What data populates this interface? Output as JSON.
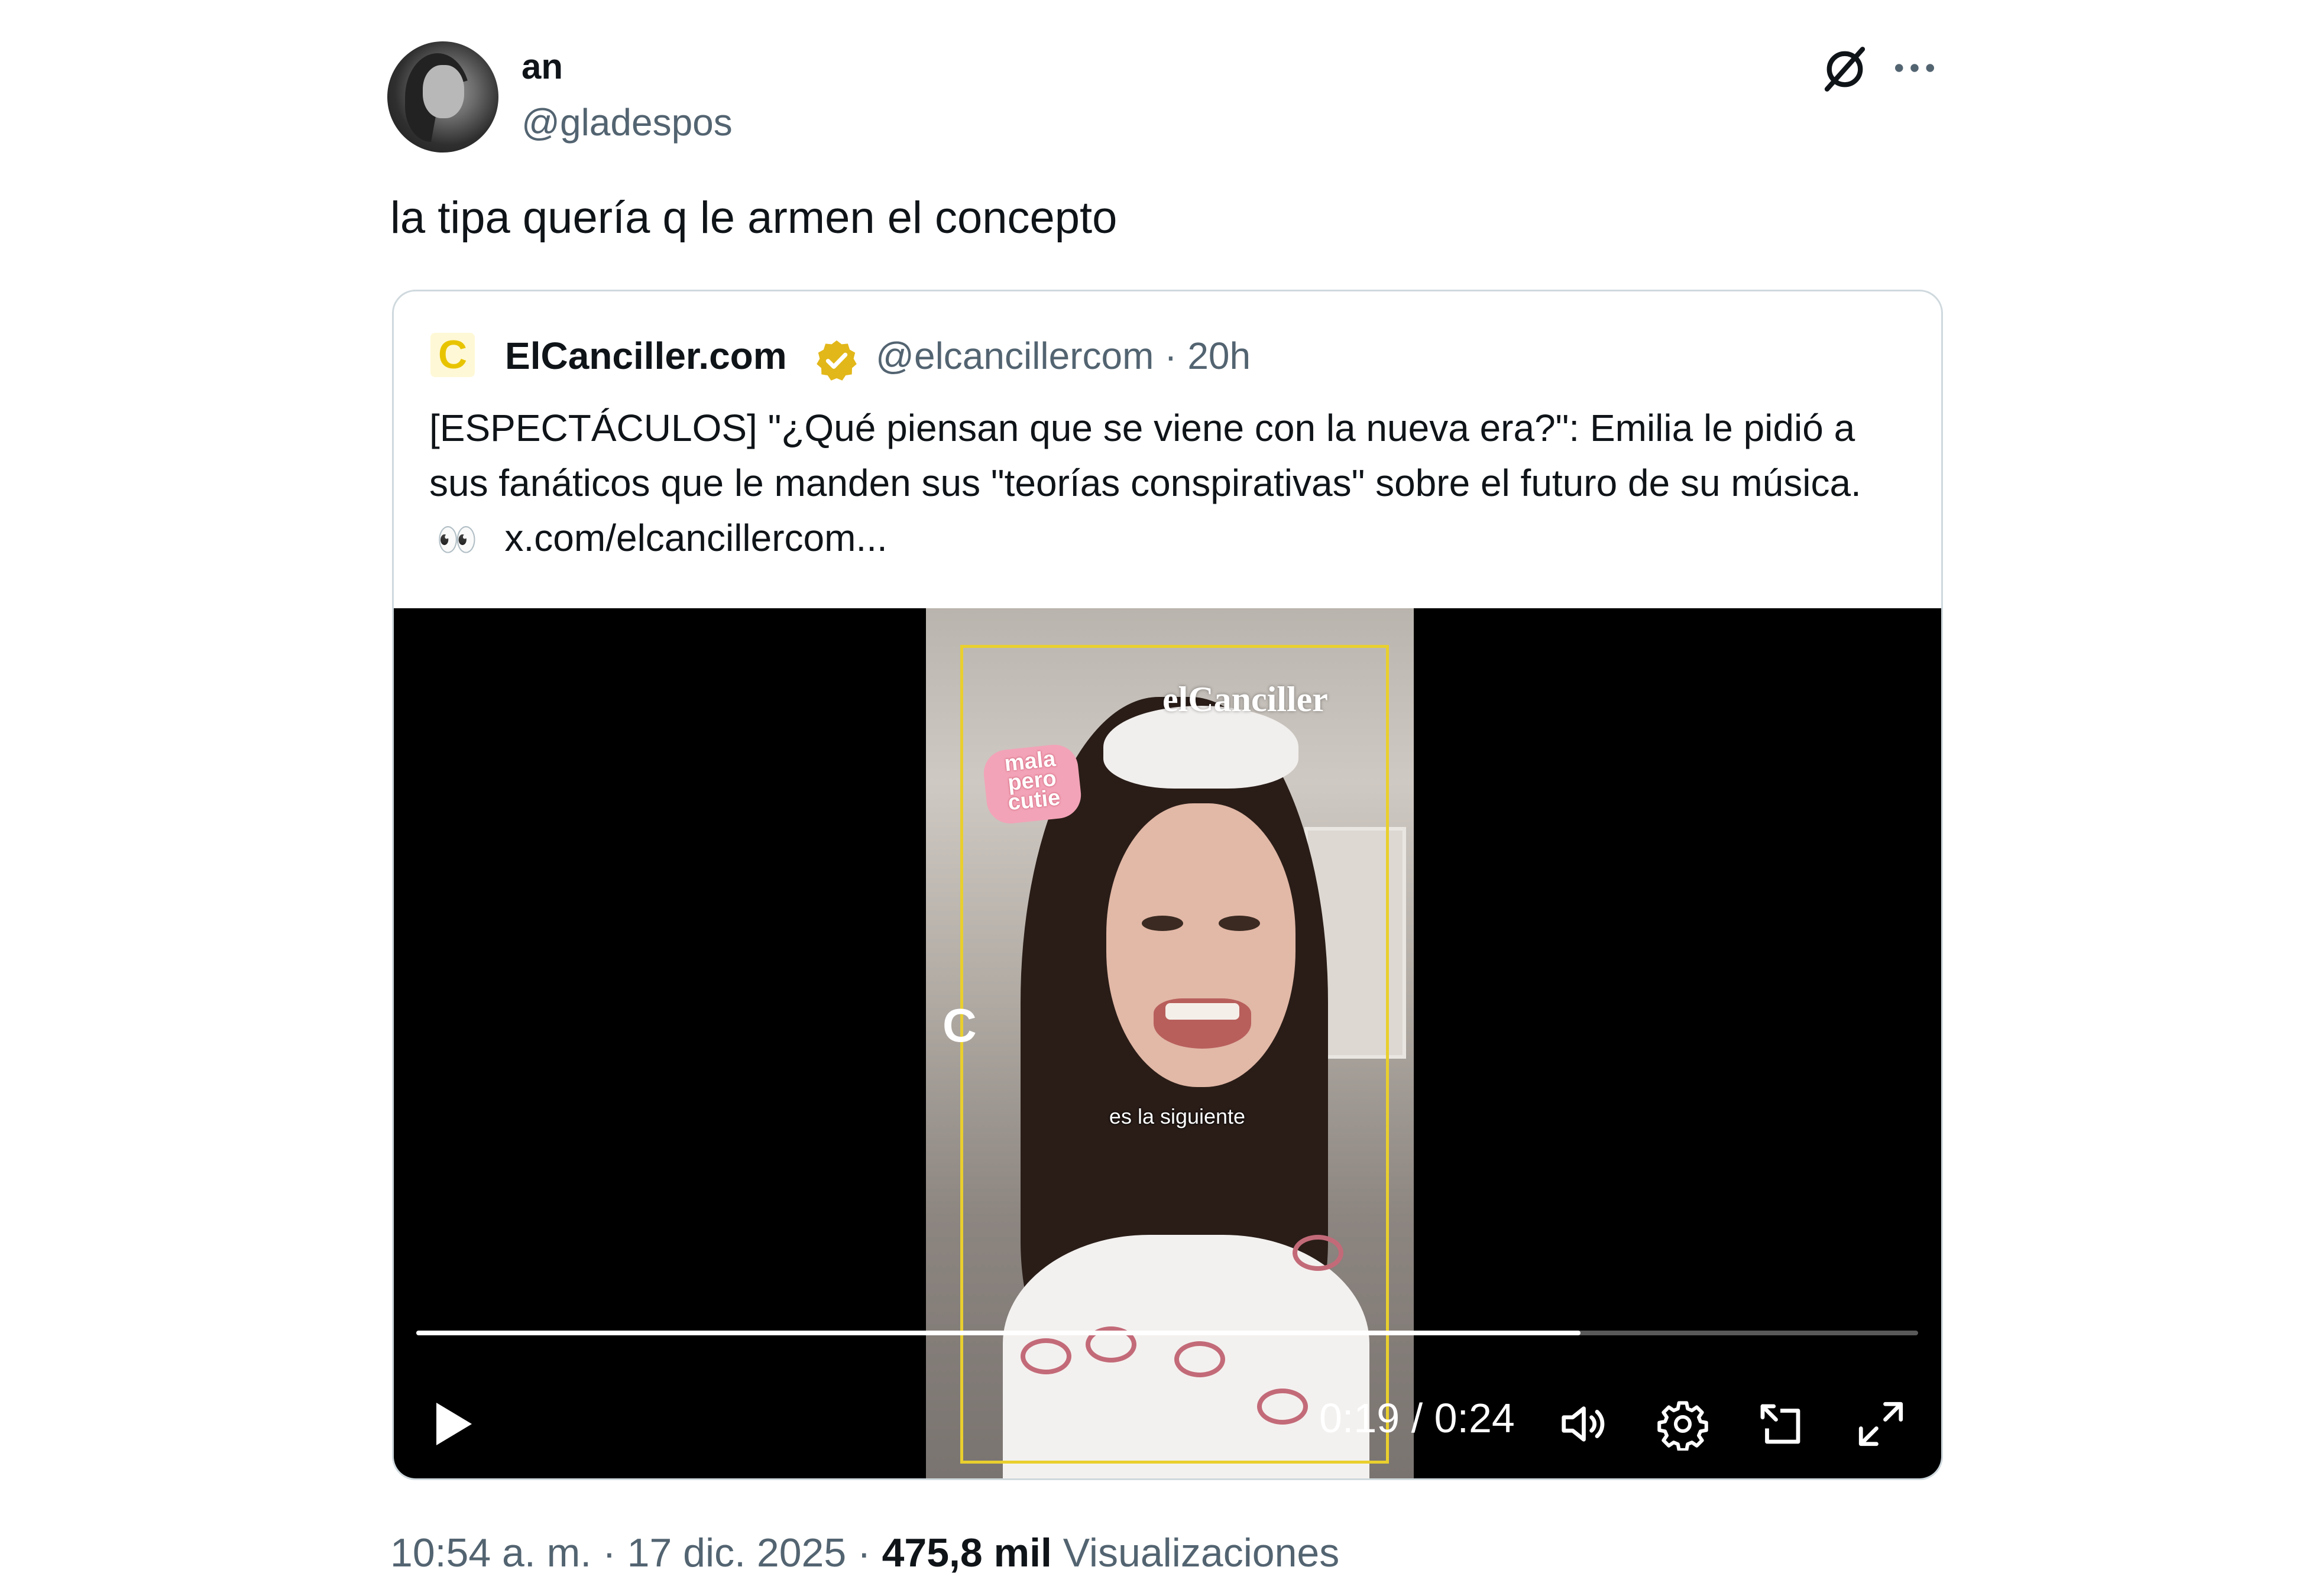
{
  "author": {
    "name": "an",
    "handle": "@gladespos"
  },
  "tweet": {
    "text": "la tipa quería q le armen el concepto"
  },
  "header_icons": {
    "grok": "grok-icon",
    "more": "more-icon"
  },
  "quote": {
    "logo_letter": "C",
    "name": "ElCanciller.com",
    "handle_time": "@elcancillercom · 20h",
    "text": "[ESPECTÁCULOS] \"¿Qué piensan que se viene con la nueva era?\": Emilia le pidió a sus fanáticos que le manden sus \"teorías conspirativas\" sobre el futuro de su música.",
    "emoji": "👀",
    "link": "x.com/elcancillercom..."
  },
  "video": {
    "overlay_brand": "elCanciller",
    "sticker": "mala pero cutie",
    "corner_mark": "C",
    "caption": "es la siguiente",
    "time": "0:19 / 0:24",
    "progress": 0.775
  },
  "footer": {
    "time": "10:54 a. m. · 17 dic. 2025 · ",
    "views": "475,8 mil",
    "views_label": " Visualizaciones"
  },
  "colors": {
    "accent": "#1d9bf0",
    "verified_gold": "#e2b719",
    "secondary_text": "#536471",
    "border": "#cfd9de"
  }
}
